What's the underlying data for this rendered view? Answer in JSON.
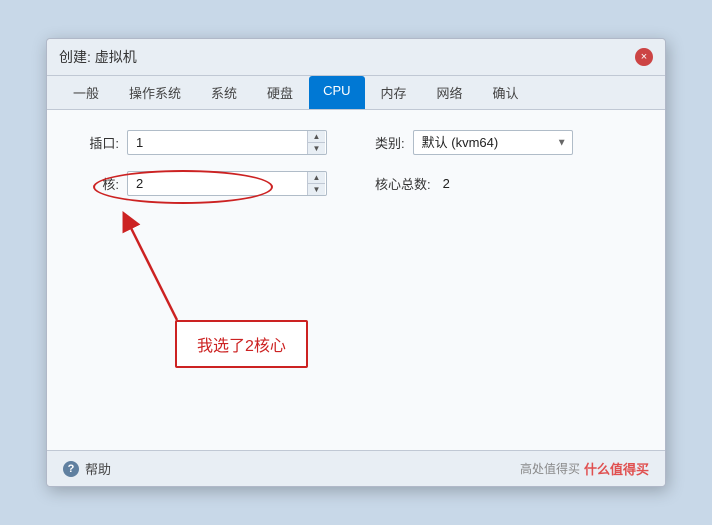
{
  "dialog": {
    "title": "创建: 虚拟机",
    "close_label": "×"
  },
  "tabs": [
    {
      "label": "一般",
      "active": false
    },
    {
      "label": "操作系统",
      "active": false
    },
    {
      "label": "系统",
      "active": false
    },
    {
      "label": "硬盘",
      "active": false
    },
    {
      "label": "CPU",
      "active": true
    },
    {
      "label": "内存",
      "active": false
    },
    {
      "label": "网络",
      "active": false
    },
    {
      "label": "确认",
      "active": false
    }
  ],
  "form": {
    "socket_label": "插口:",
    "socket_value": "1",
    "core_label": "核:",
    "core_value": "2",
    "type_label": "类别:",
    "type_value": "默认 (kvm64)",
    "total_cores_label": "核心总数:",
    "total_cores_value": "2"
  },
  "annotation": {
    "callout_text": "我选了2核心"
  },
  "footer": {
    "help_label": "帮助",
    "watermark": "高处值得买",
    "watermark_brand": "什么值得买"
  }
}
